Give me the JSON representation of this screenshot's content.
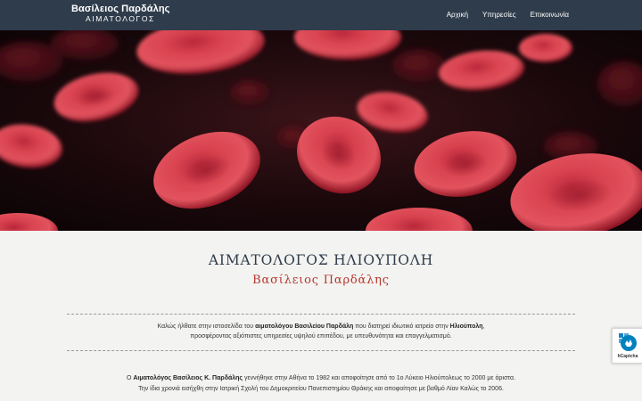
{
  "header": {
    "brand_name": "Βασίλειος Παρδάλης",
    "brand_subtitle": "ΑΙΜΑΤΟΛΟΓΟΣ",
    "nav": [
      {
        "label": "Αρχική"
      },
      {
        "label": "Υπηρεσίες"
      },
      {
        "label": "Επικοινωνία"
      }
    ]
  },
  "main": {
    "title": "ΑΙΜΑΤΟΛΟΓΟΣ ΗΛΙΟΥΠΟΛΗ",
    "subtitle": "Βασίλειος Παρδάλης",
    "intro": {
      "t1": "Καλώς ήλθατε στην ιστοσελίδα του ",
      "b1": "αιματολόγου Βασιλείου Παρδάλη",
      "t2": " που διατηρεί ιδιωτικό ιατρείο στην ",
      "b2": "Ηλιούπολη",
      "t3": ",",
      "line2": "προσφέροντας αξιόπιστες υπηρεσίες υψηλού επιπέδου, με υπευθυνότητα και επαγγελματισμό."
    },
    "bio": {
      "t1": "Ο ",
      "b1": "Αιματολόγος Βασίλειος Κ. Παρδάλης",
      "t2": " γεννήθηκε στην Αθήνα το 1982 και αποφοίτησε από το 1ο Λύκειο Ηλιούπολεως το 2000 με άριστα.",
      "t3": "Την ίδια χρονιά εισήχθη στην Ιατρική Σχολή του Δημοκριτείου Πανεπιστημίου Θράκης και αποφοίτησε με βαθμό Λίαν Καλώς το 2006."
    }
  },
  "captcha": {
    "label": "hCaptcha"
  },
  "colors": {
    "navbar": "#2f3c4b",
    "accent": "#b5352d",
    "background": "#f3f3f1"
  }
}
